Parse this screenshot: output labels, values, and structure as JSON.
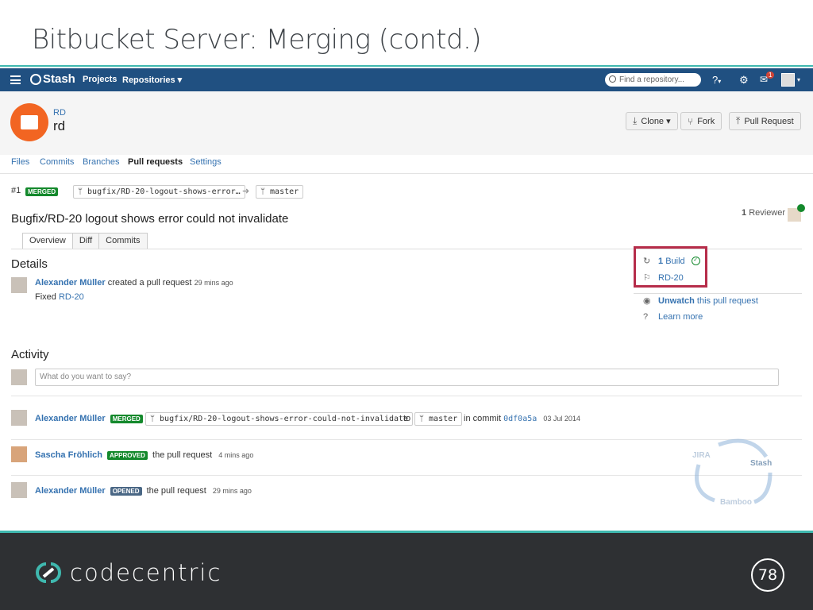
{
  "slide": {
    "title": "Bitbucket Server: Merging (contd.)",
    "page_number": "78"
  },
  "topbar": {
    "logo": "Stash",
    "nav": [
      "Projects",
      "Repositories ▾"
    ],
    "search_placeholder": "Find a repository...",
    "help_icon": "?",
    "notification_count": "1"
  },
  "repo": {
    "project_key": "RD",
    "name": "rd",
    "buttons": {
      "clone": "Clone ▾",
      "fork": "Fork",
      "pull_request": "Pull Request"
    }
  },
  "repo_tabs": [
    "Files",
    "Commits",
    "Branches",
    "Pull requests",
    "Settings"
  ],
  "pull_request": {
    "id": "#1",
    "state": "MERGED",
    "source_branch_short": "bugfix/RD-20-logout-shows-error…",
    "target_branch": "master",
    "title": "Bugfix/RD-20 logout shows error could not invalidate",
    "reviewer_count": "1",
    "reviewer_label": "Reviewer",
    "subtabs": [
      "Overview",
      "Diff",
      "Commits"
    ]
  },
  "details": {
    "heading": "Details",
    "author": "Alexander Müller",
    "action": "created a pull request",
    "time": "29 mins ago",
    "description_prefix": "Fixed",
    "description_link": "RD-20"
  },
  "sidebar": {
    "build_count": "1",
    "build_label": "Build",
    "issue": "RD-20",
    "unwatch": "Unwatch",
    "unwatch_suffix": "this pull request",
    "learn_more": "Learn more"
  },
  "activity": {
    "heading": "Activity",
    "comment_placeholder": "What do you want to say?",
    "events": [
      {
        "author": "Alexander Müller",
        "lozenge": "MERGED",
        "source_branch": "bugfix/RD-20-logout-shows-error-could-not-invalidate",
        "to": "to",
        "target_branch": "master",
        "commit_label": "in commit",
        "commit": "0df0a5a",
        "date": "03 Jul 2014"
      },
      {
        "author": "Sascha Fröhlich",
        "lozenge": "APPROVED",
        "text": "the pull request",
        "time": "4 mins ago"
      },
      {
        "author": "Alexander Müller",
        "lozenge": "OPENED",
        "text": "the pull request",
        "time": "29 mins ago"
      }
    ]
  },
  "cycle_graphic": {
    "jira": "JIRA",
    "stash": "Stash",
    "bamboo": "Bamboo"
  },
  "footer": {
    "brand": "codecentric"
  },
  "colors": {
    "topbar": "#205081",
    "link": "#3572b0",
    "merged": "#14892c",
    "opened": "#4a6785",
    "highlight": "#b62d4a",
    "footer": "#2e3033",
    "accent": "#3fb8af",
    "repo_avatar": "#f26522"
  }
}
